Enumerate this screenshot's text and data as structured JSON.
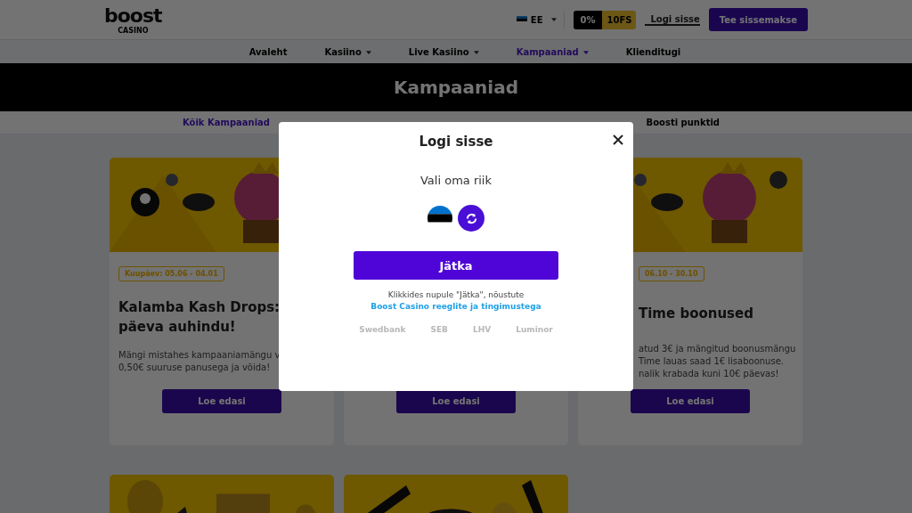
{
  "header": {
    "logo": "boost",
    "logo_sub": "CASINO",
    "language": "EE",
    "bonus_percent": "0%",
    "bonus_spins": "10FS",
    "login_link": "Logi sisse",
    "deposit_button": "Tee sissemakse"
  },
  "nav": [
    {
      "label": "Avaleht",
      "dropdown": false,
      "selected": false
    },
    {
      "label": "Kasiino",
      "dropdown": true,
      "selected": false
    },
    {
      "label": "Live Kasiino",
      "dropdown": true,
      "selected": false
    },
    {
      "label": "Kampaaniad",
      "dropdown": true,
      "selected": true
    },
    {
      "label": "Klienditugi",
      "dropdown": false,
      "selected": false
    }
  ],
  "banner": {
    "title": "Kampaaniad"
  },
  "subtabs": [
    {
      "label": "Kõik Kampaaniad",
      "selected": true
    },
    {
      "label": "Boosti punktid",
      "selected": false
    }
  ],
  "cards": [
    {
      "kind": "left",
      "badge": "Kuupäev: 05.06 - 04.01",
      "title_lines": [
        "Kalamba Kash Drops:",
        "päeva auhindu!"
      ],
      "text_lines": [
        "Mängi mistahes kampaaniamängu v",
        "0,50€ suuruse panusega ja võida!"
      ],
      "button": "Loe edasi"
    },
    {
      "kind": "covered",
      "button": "Loe edasi"
    },
    {
      "kind": "right",
      "badge": "06.10 - 30.10",
      "title_lines": [
        "Time boonused"
      ],
      "text_lines": [
        "atud 3€ ja mängitud boonusmängu",
        "Time lauas saad 1€ lisaboonuse.",
        "nalik krabada kuni 10€ päevas!"
      ],
      "button": "Loe edasi"
    }
  ],
  "modal": {
    "title": "Logi sisse",
    "subtitle": "Vali oma riik",
    "continue_button": "Jätka",
    "legal_text": "Klikkides nupule \"Jätka\", nõustute",
    "legal_link": "Boost Casino reeglite ja tingimustega",
    "banks": [
      "Swedbank",
      "SEB",
      "LHV",
      "Luminor"
    ]
  }
}
